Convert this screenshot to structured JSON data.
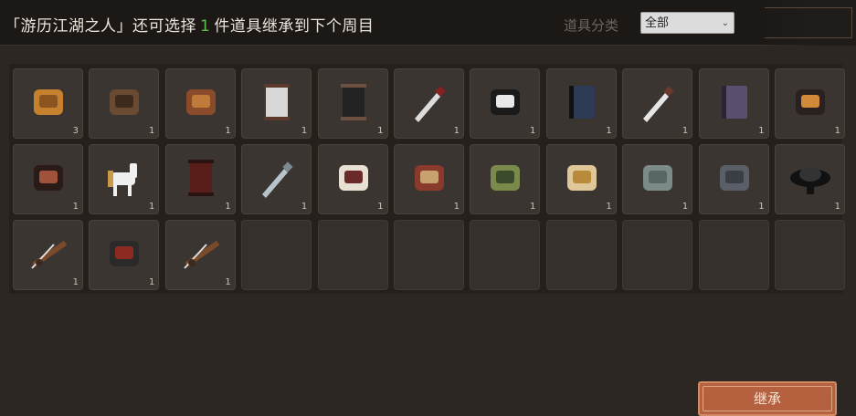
{
  "header": {
    "title_prefix": "「游历江湖之人」还可选择",
    "count": "1",
    "title_suffix": "件道具继承到下个周目",
    "category_label": "道具分类",
    "category_value": "全部"
  },
  "slots": [
    {
      "icon": "leather-hide-icon",
      "qty": "3"
    },
    {
      "icon": "wooden-logs-icon",
      "qty": "1"
    },
    {
      "icon": "prayer-beads-icon",
      "qty": "1"
    },
    {
      "icon": "hanging-scroll-icon",
      "qty": "1"
    },
    {
      "icon": "dark-banner-icon",
      "qty": "1"
    },
    {
      "icon": "dagger-icon",
      "qty": "1"
    },
    {
      "icon": "black-garment-icon",
      "qty": "1"
    },
    {
      "icon": "blue-book-icon",
      "qty": "1"
    },
    {
      "icon": "short-sword-icon",
      "qty": "1"
    },
    {
      "icon": "purple-book-icon",
      "qty": "1"
    },
    {
      "icon": "brush-icon",
      "qty": "1"
    },
    {
      "icon": "cloak-icon",
      "qty": "1"
    },
    {
      "icon": "white-horse-icon",
      "qty": "1"
    },
    {
      "icon": "red-robe-icon",
      "qty": "1"
    },
    {
      "icon": "blade-icon",
      "qty": "1"
    },
    {
      "icon": "book-stack-icon",
      "qty": "1"
    },
    {
      "icon": "bamboo-slips-icon",
      "qty": "1"
    },
    {
      "icon": "green-gourd-icon",
      "qty": "1"
    },
    {
      "icon": "golden-hand-icon",
      "qty": "1"
    },
    {
      "icon": "grey-map-icon",
      "qty": "1"
    },
    {
      "icon": "dark-map-icon",
      "qty": "1"
    },
    {
      "icon": "black-hat-icon",
      "qty": "1"
    },
    {
      "icon": "fishing-rod-icon",
      "qty": "1"
    },
    {
      "icon": "dark-armor-icon",
      "qty": "1"
    },
    {
      "icon": "fishing-rod-icon",
      "qty": "1"
    }
  ],
  "button": {
    "label": "继承"
  }
}
